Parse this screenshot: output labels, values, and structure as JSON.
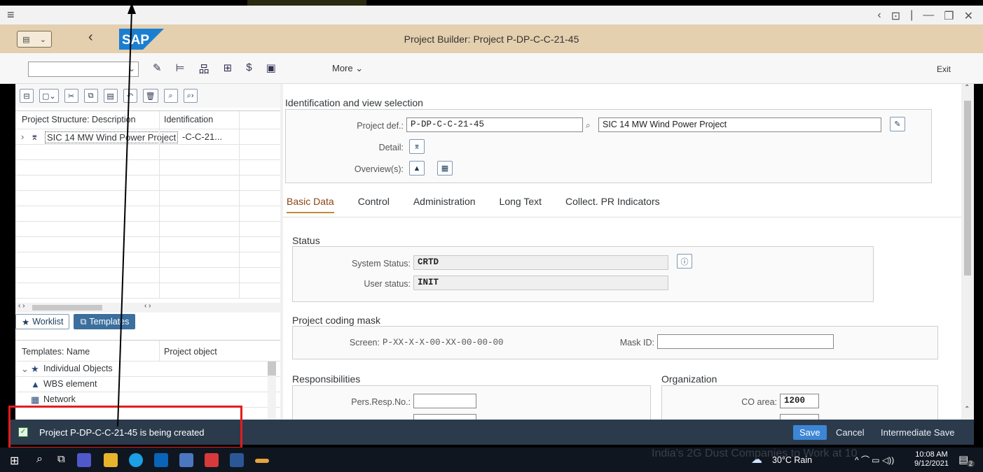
{
  "window": {
    "title": "Project Builder: Project P-DP-C-C-21-45",
    "controls": [
      "‹",
      "⊡",
      "|",
      "—",
      "❐",
      "✕"
    ]
  },
  "toolbar": {
    "more_label": "More",
    "exit_label": "Exit"
  },
  "left_pane": {
    "structure_headers": [
      "Project Structure: Description",
      "Identification"
    ],
    "structure_row": {
      "description": "SIC 14 MW Wind Power Project",
      "identification": "-C-C-21..."
    },
    "tabs": [
      {
        "label": "Worklist",
        "active": false
      },
      {
        "label": "Templates",
        "active": true
      }
    ],
    "template_headers": [
      "Templates: Name",
      "Project object"
    ],
    "template_items": [
      {
        "label": "Individual Objects",
        "icon": "star-icon"
      },
      {
        "label": "WBS element",
        "icon": "triangle-icon"
      },
      {
        "label": "Network",
        "icon": "network-icon"
      }
    ]
  },
  "identification": {
    "title": "Identification and view selection",
    "project_def_label": "Project def.:",
    "project_def_value": "P-DP-C-C-21-45",
    "project_desc_value": "SIC 14 MW Wind Power Project",
    "detail_label": "Detail:",
    "overview_label": "Overview(s):"
  },
  "tabs": [
    {
      "label": "Basic Data",
      "active": true
    },
    {
      "label": "Control",
      "active": false
    },
    {
      "label": "Administration",
      "active": false
    },
    {
      "label": "Long Text",
      "active": false
    },
    {
      "label": "Collect. PR Indicators",
      "active": false
    }
  ],
  "status": {
    "title": "Status",
    "system_status_label": "System Status:",
    "system_status_value": "CRTD",
    "user_status_label": "User status:",
    "user_status_value": "INIT"
  },
  "coding_mask": {
    "title": "Project coding mask",
    "screen_label": "Screen:",
    "screen_value": "P-XX-X-X-00-XX-00-00-00",
    "mask_id_label": "Mask ID:",
    "mask_id_value": ""
  },
  "responsibilities": {
    "title": "Responsibilities",
    "pers_resp_label": "Pers.Resp.No.:",
    "pers_resp_value": ""
  },
  "organization": {
    "title": "Organization",
    "co_area_label": "CO area:",
    "co_area_value": "1200"
  },
  "statusbar": {
    "message": "Project P-DP-C-C-21-45 is being created",
    "save_label": "Save",
    "cancel_label": "Cancel",
    "intermediate_save_label": "Intermediate Save"
  },
  "taskbar": {
    "news_text": "India's 2G Dust Companies to Work at 10",
    "weather": "30°C  Rain",
    "time": "10:08 AM",
    "date": "9/12/2021",
    "notifications": "2"
  },
  "colors": {
    "shell": "#e4cfae",
    "statusbar": "#2b3b4c",
    "save_button": "#3d86d6",
    "highlight_box": "#e31d1d",
    "active_tab": "#c28a3a"
  }
}
